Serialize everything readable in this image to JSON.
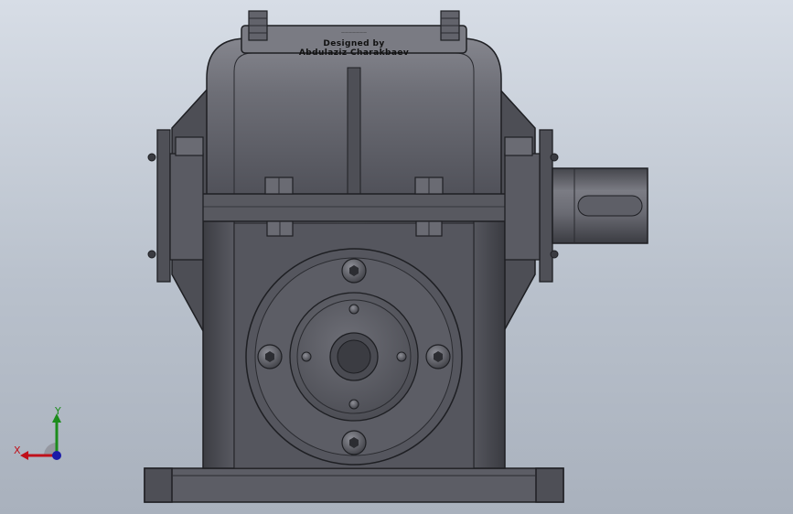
{
  "viewport": {
    "background_top": "#d7dde6",
    "background_bottom": "#a9b1bd",
    "model_color": "#5a5b62"
  },
  "model": {
    "name_plate": {
      "line1": "Designed by",
      "line2": "Abdulaziz Charakbaev",
      "small_line": "———————"
    }
  },
  "triad": {
    "x_label": "X",
    "y_label": "Y",
    "x_color": "#c0101a",
    "y_color": "#1c8c1c",
    "z_color": "#1a1aa8"
  }
}
